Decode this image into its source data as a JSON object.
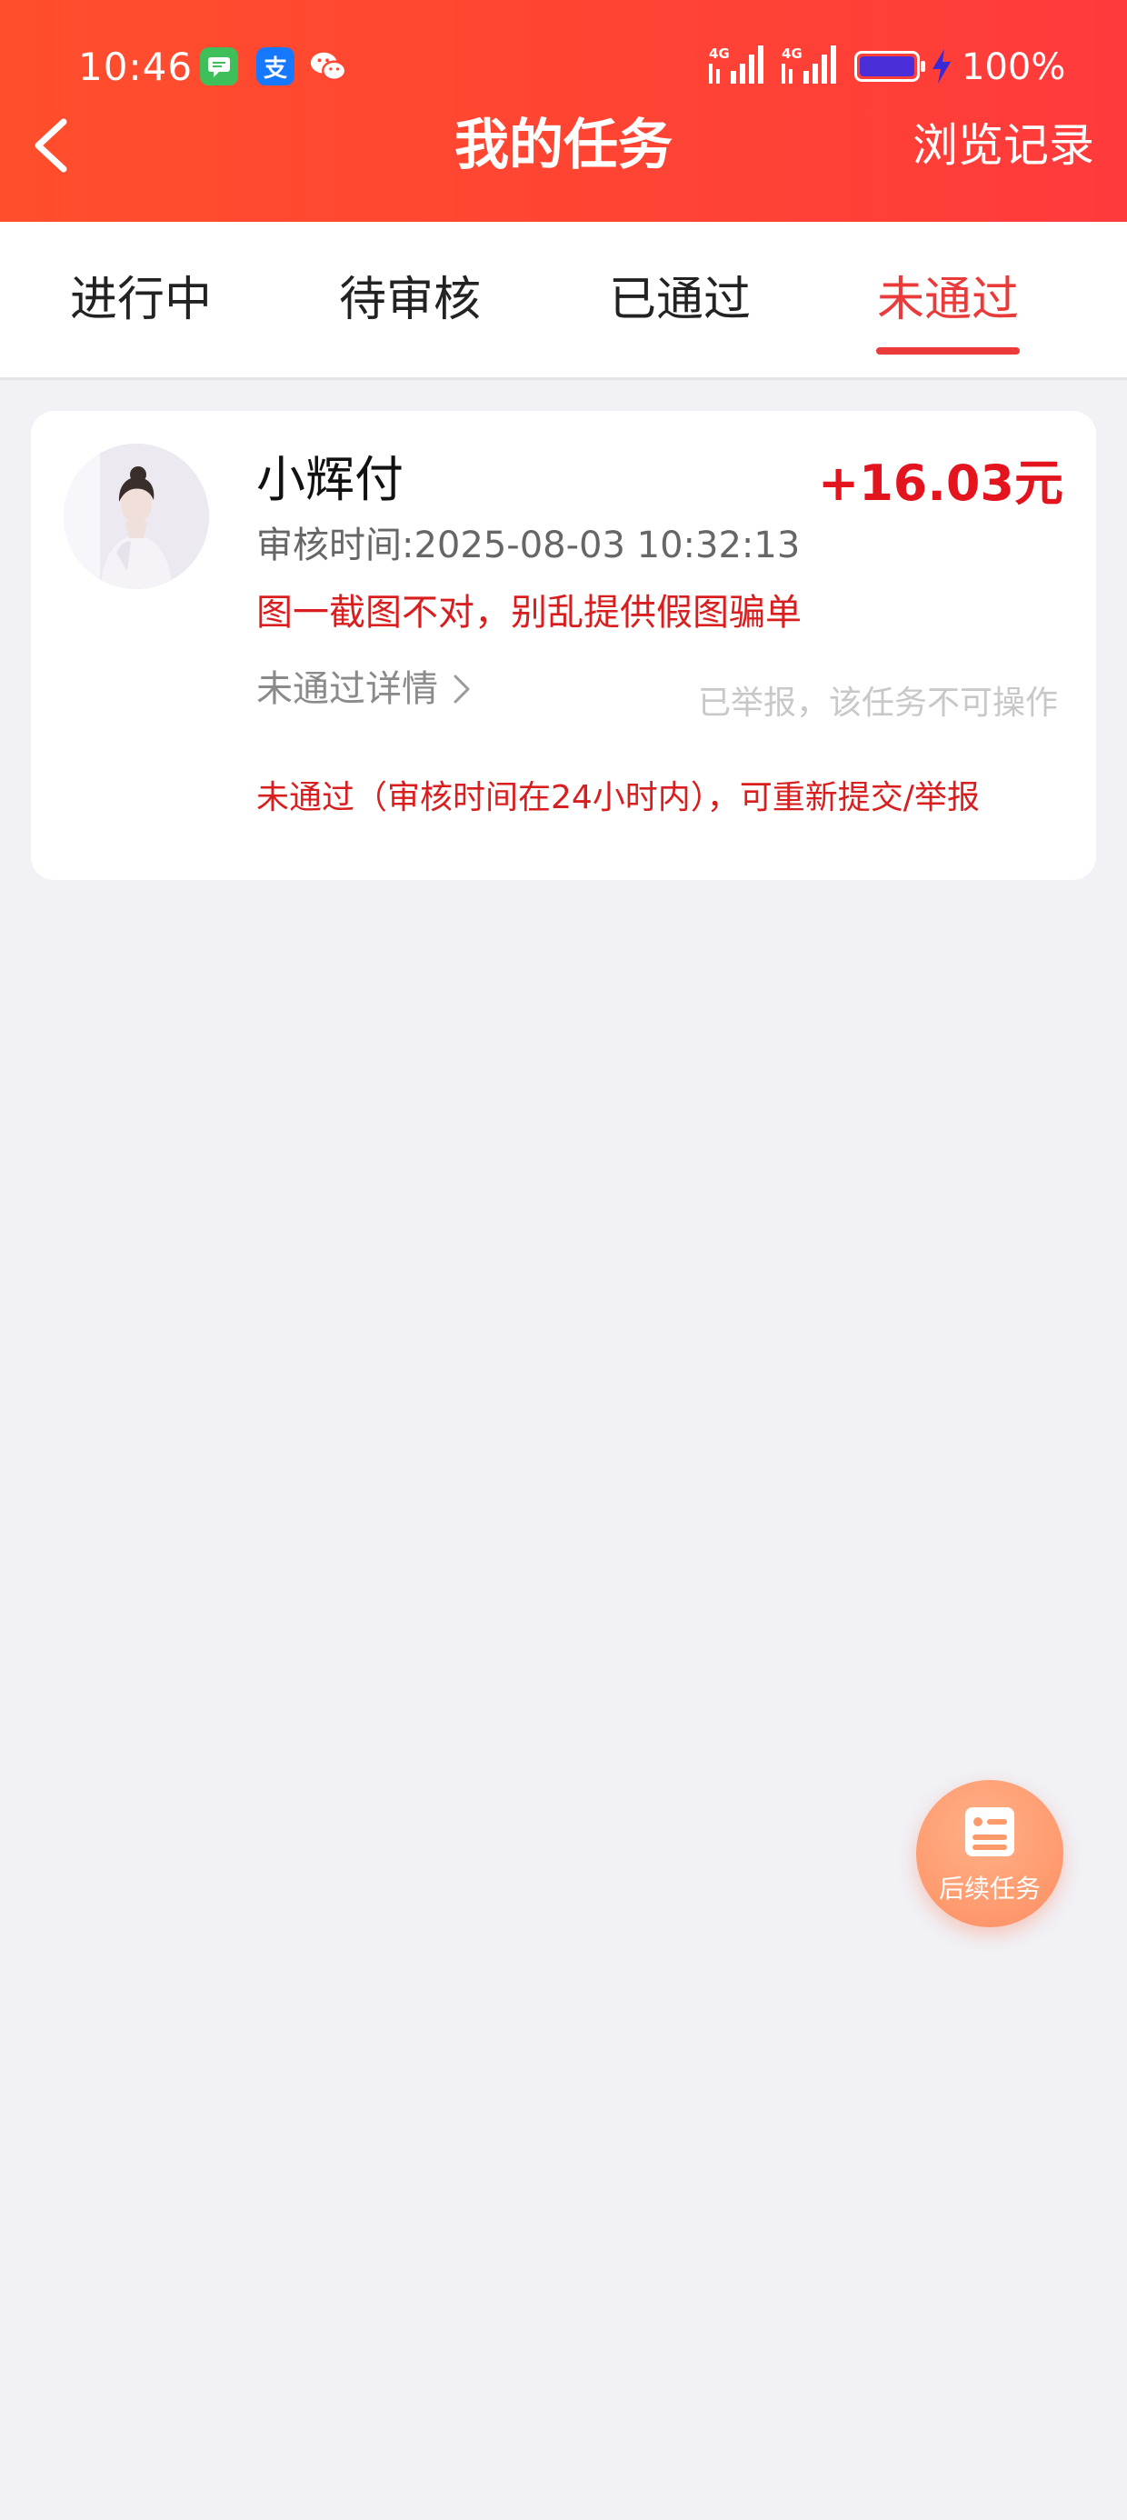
{
  "status_bar": {
    "time": "10:46",
    "network_1": "4G",
    "network_2": "4G",
    "battery_percent": "100%",
    "battery_level": 1.0,
    "app_icons": [
      "messages-icon",
      "alipay-icon",
      "wechat-icon"
    ],
    "alipay_glyph": "支"
  },
  "header": {
    "title": "我的任务",
    "history_label": "浏览记录",
    "background_color": "#ff4433"
  },
  "tabs": {
    "items": [
      {
        "label": "进行中"
      },
      {
        "label": "待审核"
      },
      {
        "label": "已通过"
      },
      {
        "label": "未通过"
      }
    ],
    "active_index": 3,
    "active_color": "#ea3a3a"
  },
  "task_card": {
    "name": "小辉付",
    "reward": "+16.03元",
    "review_time": "审核时间:2025-08-03 10:32:13",
    "reject_reason": "图一截图不对，别乱提供假图骗单",
    "detail_link": "未通过详情",
    "reported_note": "已举报，该任务不可操作",
    "resubmit_note": "未通过（审核时间在24小时内），可重新提交/举报"
  },
  "fab": {
    "label": "后续任务",
    "icon": "task-list-icon"
  }
}
